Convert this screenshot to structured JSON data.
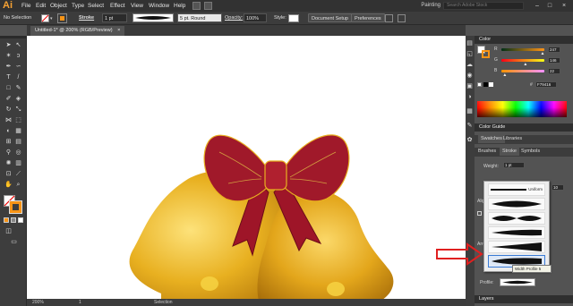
{
  "app": {
    "logo": "Ai",
    "workspace": "Painting",
    "search_placeholder": "Search Adobe Stock"
  },
  "menu": [
    "File",
    "Edit",
    "Object",
    "Type",
    "Select",
    "Effect",
    "View",
    "Window",
    "Help"
  ],
  "window_controls": {
    "minimize": "–",
    "maximize": "□",
    "close": "×"
  },
  "control_bar": {
    "selection": "No Selection",
    "stroke_label": "Stroke",
    "stroke_weight": "1 pt",
    "brush": "5 pt. Round",
    "opacity_label": "Opacity:",
    "opacity_value": "100%",
    "style_label": "Style:",
    "doc_setup": "Document Setup",
    "preferences": "Preferences"
  },
  "document": {
    "tab": "Untitled-1* @ 200% (RGB/Preview)",
    "tab_close": "×"
  },
  "status": {
    "zoom": "200%",
    "page": "1",
    "tool": "Selection"
  },
  "color_panel": {
    "title": "Color",
    "channels": [
      {
        "label": "R",
        "value": "247",
        "fraction": 0.97,
        "color": "#ff4040"
      },
      {
        "label": "G",
        "value": "146",
        "fraction": 0.57,
        "color": "#40c040"
      },
      {
        "label": "B",
        "value": "22",
        "fraction": 0.09,
        "color": "#4060ff"
      }
    ],
    "hex_prefix": "#",
    "hex": "F79416"
  },
  "color_guide": {
    "title": "Color Guide"
  },
  "swatch_tabs": [
    "Swatches",
    "Libraries"
  ],
  "stroke_tabs": [
    "Brushes",
    "Stroke",
    "Symbols"
  ],
  "stroke_panel": {
    "weight_label": "Weight:",
    "weight_value": "1 pt",
    "align_label": "Align",
    "arrows_label": "Arro",
    "profile_label": "Profile:",
    "scale_value": "10"
  },
  "profile_popup": {
    "first": "Uniform"
  },
  "tooltip": "Width Profile 5",
  "layers": {
    "title": "Layers"
  },
  "colors": {
    "accent": "#f79416",
    "bow": "#a0192a",
    "bell": "#e8b020",
    "arrow": "#e02020"
  }
}
